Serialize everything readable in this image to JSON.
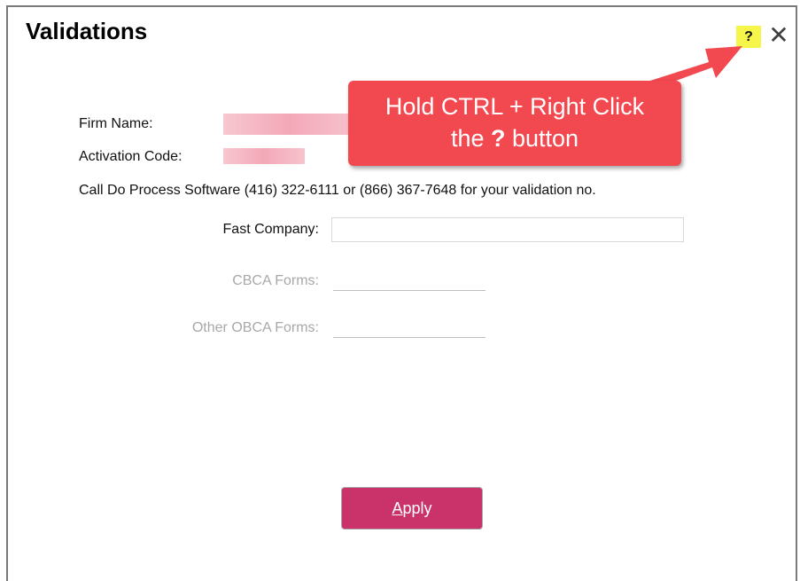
{
  "dialog": {
    "title": "Validations",
    "help_label": "?",
    "close_label": "✕"
  },
  "firm": {
    "firm_name_label": "Firm Name:",
    "activation_code_label": "Activation Code:"
  },
  "notice": "Call Do Process Software (416) 322-6111 or (866) 367-7648 for your validation no.",
  "fields": {
    "fast_company_label": "Fast Company:",
    "fast_company_value": "",
    "cbca_label": "CBCA Forms:",
    "cbca_value": "",
    "other_obca_label": "Other OBCA Forms:",
    "other_obca_value": ""
  },
  "callout": {
    "line1": "Hold CTRL + Right Click",
    "line2_pre": "the ",
    "line2_q": "?",
    "line2_post": " button"
  },
  "apply": {
    "mnemonic": "A",
    "rest": "pply"
  },
  "colors": {
    "accent_button": "#c9336a",
    "callout": "#f2484f",
    "help_highlight": "#f6f64a"
  }
}
